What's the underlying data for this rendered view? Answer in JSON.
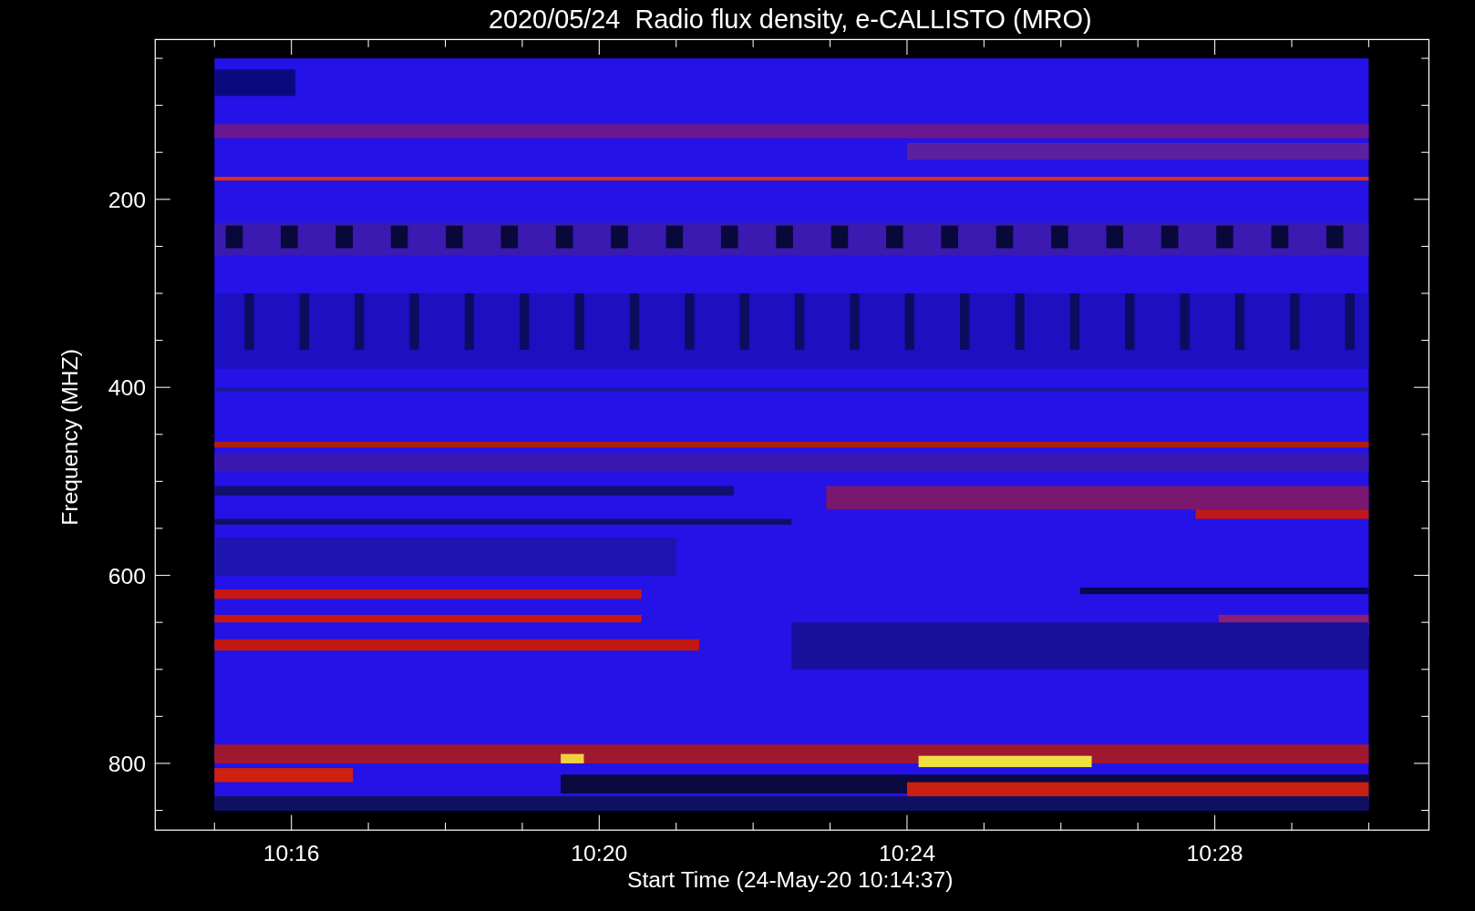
{
  "title": "2020/05/24  Radio flux density, e-CALLISTO (MRO)",
  "y_axis": {
    "label": "Frequency (MHZ)",
    "ticks": [
      "200",
      "400",
      "600",
      "800"
    ]
  },
  "x_axis": {
    "label": "Start Time (24-May-20 10:14:37)",
    "ticks": [
      "10:16",
      "10:20",
      "10:24",
      "10:28"
    ]
  }
}
